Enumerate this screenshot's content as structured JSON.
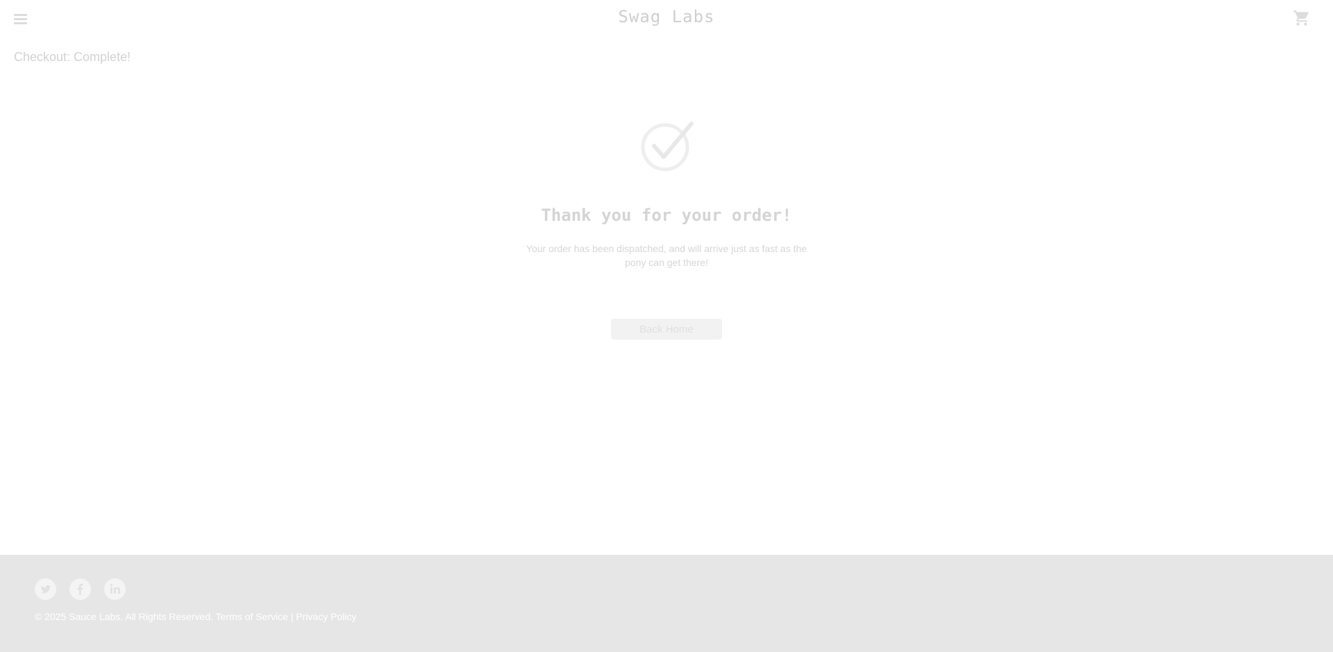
{
  "header": {
    "app_logo": "Swag Labs",
    "menu_icon": "hamburger-menu-icon",
    "cart_icon": "shopping-cart-icon"
  },
  "page": {
    "title": "Checkout: Complete!"
  },
  "complete": {
    "icon": "checkmark-circle-icon",
    "header": "Thank you for your order!",
    "text": "Your order has been dispatched, and will arrive just as fast as the pony can get there!",
    "back_home_label": "Back Home"
  },
  "footer": {
    "social": [
      {
        "name": "Twitter",
        "icon": "twitter-icon"
      },
      {
        "name": "Facebook",
        "icon": "facebook-icon"
      },
      {
        "name": "LinkedIn",
        "icon": "linkedin-icon"
      }
    ],
    "copyright": "© 2025 Sauce Labs. All Rights Reserved.",
    "terms_label": "Terms of Service",
    "separator": "|",
    "privacy_label": "Privacy Policy"
  },
  "colors": {
    "footer_bg": "#e6e6e6",
    "muted_text": "#d2d2d2",
    "button_bg": "#f2f2f2"
  }
}
